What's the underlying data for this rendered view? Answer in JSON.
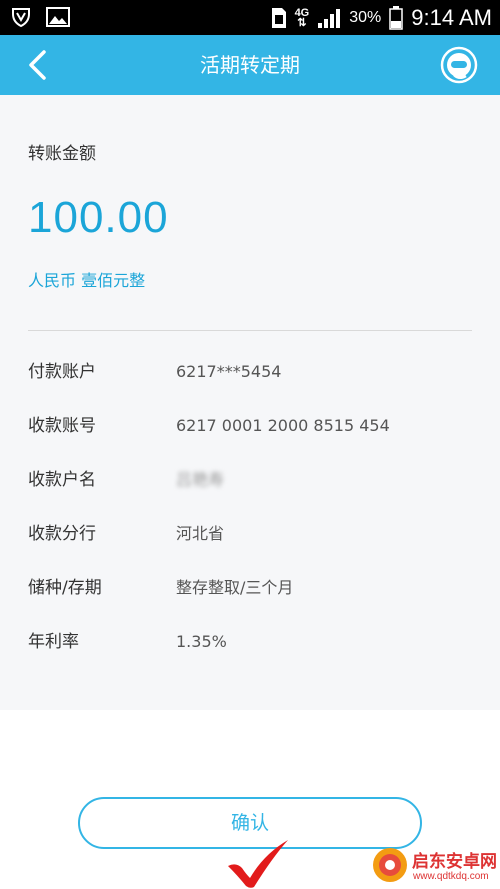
{
  "status_bar": {
    "network": "4G",
    "battery": "30%",
    "time": "9:14 AM"
  },
  "nav": {
    "title": "活期转定期",
    "back_icon": "chevron-left-icon",
    "service_icon": "customer-service-icon"
  },
  "transfer": {
    "amount_label": "转账金额",
    "amount": "100.00",
    "amount_in_words": "人民币 壹佰元整"
  },
  "details": [
    {
      "label": "付款账户",
      "value": "6217***5454"
    },
    {
      "label": "收款账号",
      "value": "6217 0001 2000 8515 454"
    },
    {
      "label": "收款户名",
      "value": "吕艳寿"
    },
    {
      "label": "收款分行",
      "value": "河北省"
    },
    {
      "label": "储种/存期",
      "value": "整存整取/三个月"
    },
    {
      "label": "年利率",
      "value": "1.35%"
    }
  ],
  "confirm_label": "确认",
  "watermark": {
    "title": "启东安卓网",
    "url": "www.qdtkdq.com"
  },
  "colors": {
    "accent": "#33b5e5",
    "amount": "#1ba5d8",
    "check": "#e21b1b"
  }
}
